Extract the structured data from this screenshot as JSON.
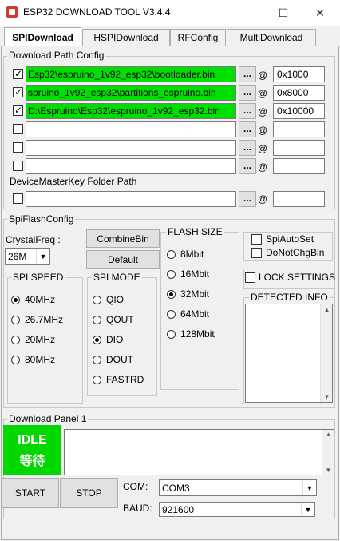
{
  "window": {
    "title": "ESP32 DOWNLOAD TOOL V3.4.4",
    "minimize": "—",
    "maximize": "☐",
    "close": "✕"
  },
  "tabs": [
    "SPIDownload",
    "HSPIDownload",
    "RFConfig",
    "MultiDownload"
  ],
  "download_path": {
    "legend": "Download Path Config",
    "rows": [
      {
        "checked": true,
        "path": "Esp32\\espruino_1v92_esp32\\bootloader.bin",
        "address": "0x1000"
      },
      {
        "checked": true,
        "path": "spruino_1v92_esp32\\partitions_espruino.bin",
        "address": "0x8000"
      },
      {
        "checked": true,
        "path": "D:\\Espruino\\Esp32\\espruino_1v92_esp32.bin",
        "address": "0x10000"
      },
      {
        "checked": false,
        "path": "",
        "address": ""
      },
      {
        "checked": false,
        "path": "",
        "address": ""
      },
      {
        "checked": false,
        "path": "",
        "address": ""
      }
    ],
    "browse_label": "...",
    "at_label": "@",
    "master_key_label": "DeviceMasterKey Folder Path",
    "master_key": {
      "checked": false,
      "path": "",
      "address": ""
    }
  },
  "spi_flash": {
    "legend": "SpiFlashConfig",
    "crystal_label": "CrystalFreq :",
    "crystal_value": "26M",
    "combine_bin": "CombineBin",
    "default_btn": "Default",
    "flash_size": {
      "legend": "FLASH SIZE",
      "options": [
        "8Mbit",
        "16Mbit",
        "32Mbit",
        "64Mbit",
        "128Mbit"
      ],
      "selected": 2
    },
    "spi_speed": {
      "legend": "SPI SPEED",
      "options": [
        "40MHz",
        "26.7MHz",
        "20MHz",
        "80MHz"
      ],
      "selected": 0
    },
    "spi_mode": {
      "legend": "SPI MODE",
      "options": [
        "QIO",
        "QOUT",
        "DIO",
        "DOUT",
        "FASTRD"
      ],
      "selected": 2
    },
    "spi_auto_set": {
      "label": "SpiAutoSet",
      "checked": false
    },
    "do_not_chg_bin": {
      "label": "DoNotChgBin",
      "checked": false
    },
    "lock_settings": {
      "label": "LOCK SETTINGS",
      "checked": false
    },
    "detected_info": {
      "legend": "DETECTED INFO"
    }
  },
  "download_panel": {
    "legend": "Download Panel 1",
    "status_en": "IDLE",
    "status_zh": "等待",
    "status_color": "#00d800",
    "start": "START",
    "stop": "STOP",
    "com_label": "COM:",
    "com_value": "COM3",
    "baud_label": "BAUD:",
    "baud_value": "921600"
  }
}
